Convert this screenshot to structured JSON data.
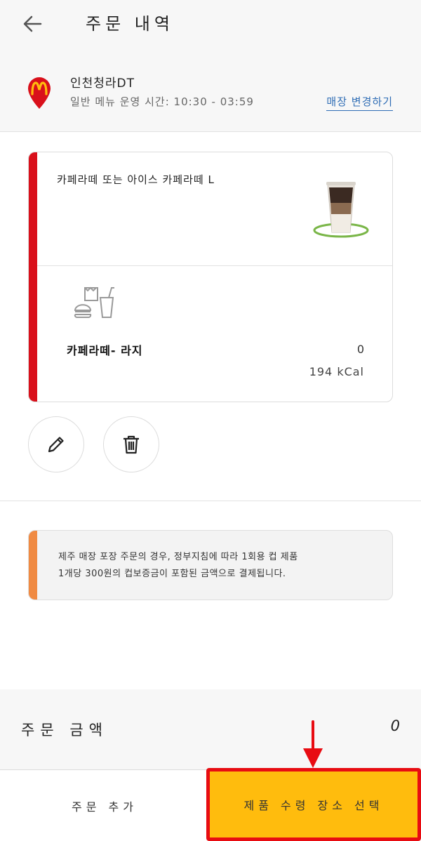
{
  "header": {
    "title": "주문 내역",
    "back_icon": "arrow-left-icon"
  },
  "store": {
    "name": "인천청라DT",
    "hours": "일반 메뉴 운영 시간: 10:30 - 03:59",
    "change_label": "매장 변경하기",
    "logo_icon": "mcdonalds-logo-pin",
    "brand_color": "#d9101b"
  },
  "order_item": {
    "name": "카페라떼 또는 아이스 카페라떼 L",
    "option_name": "카페라떼- 라지",
    "option_price": "0",
    "option_kcal": "194 kCal",
    "image_icon": "iced-cafe-latte-cup",
    "combo_icon": "combo-meal-icon",
    "accent_color": "#d9101b"
  },
  "actions": {
    "edit_icon": "pencil-icon",
    "delete_icon": "trash-icon"
  },
  "notice": {
    "line1": "제주 매장 포장 주문의 경우, 정부지침에 따라 1회용 컵 제품",
    "line2": "1개당 300원의 컵보증금이 포함된 금액으로 결제됩니다.",
    "accent_color": "#f08a42"
  },
  "footer": {
    "total_label": "주문 금액",
    "total_value": "0",
    "add_order_label": "주문 추가",
    "select_pickup_label": "제품 수령 장소 선택",
    "primary_color": "#ffbc0d",
    "highlight_color": "#e80c12"
  }
}
